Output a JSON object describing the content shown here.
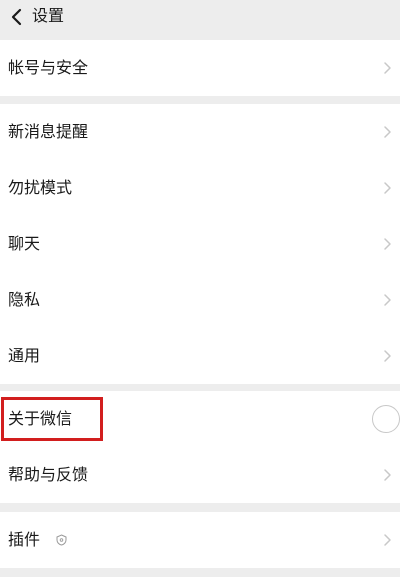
{
  "header": {
    "title": "设置"
  },
  "groups": [
    {
      "items": [
        {
          "label": "帐号与安全"
        }
      ]
    },
    {
      "items": [
        {
          "label": "新消息提醒"
        },
        {
          "label": "勿扰模式"
        },
        {
          "label": "聊天"
        },
        {
          "label": "隐私"
        },
        {
          "label": "通用"
        }
      ]
    },
    {
      "items": [
        {
          "label": "关于微信"
        },
        {
          "label": "帮助与反馈"
        }
      ]
    },
    {
      "items": [
        {
          "label": "插件"
        }
      ]
    }
  ],
  "icons": {
    "back": "chevron-left-icon",
    "row_arrow": "chevron-right-icon",
    "plugin_badge": "shield-icon"
  },
  "colors": {
    "background": "#ededed",
    "card": "#ffffff",
    "highlight": "#d21e1e",
    "chevron": "#c8c8c8"
  }
}
